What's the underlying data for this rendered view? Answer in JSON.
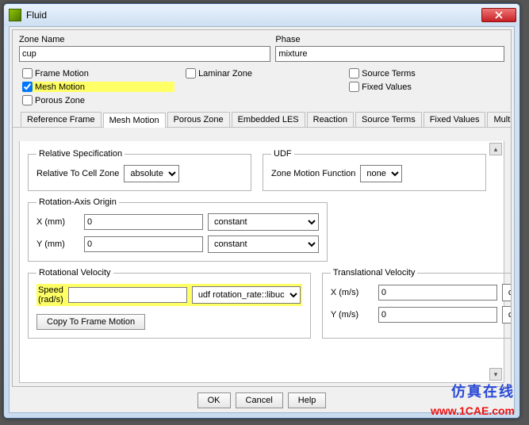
{
  "window": {
    "title": "Fluid"
  },
  "zone": {
    "name_label": "Zone Name",
    "name_value": "cup",
    "phase_label": "Phase",
    "phase_value": "mixture"
  },
  "options": {
    "frame_motion": {
      "label": "Frame Motion",
      "checked": false
    },
    "laminar_zone": {
      "label": "Laminar Zone",
      "checked": false
    },
    "source_terms": {
      "label": "Source Terms",
      "checked": false
    },
    "mesh_motion": {
      "label": "Mesh Motion",
      "checked": true
    },
    "fixed_values": {
      "label": "Fixed Values",
      "checked": false
    },
    "porous_zone": {
      "label": "Porous Zone",
      "checked": false
    }
  },
  "tabs": {
    "reference_frame": "Reference Frame",
    "mesh_motion": "Mesh Motion",
    "porous_zone": "Porous Zone",
    "embedded_les": "Embedded LES",
    "reaction": "Reaction",
    "source_terms": "Source Terms",
    "fixed_values": "Fixed Values",
    "multiphase": "Multiphase"
  },
  "panel": {
    "rel_spec_legend": "Relative Specification",
    "rel_spec_label": "Relative To Cell Zone",
    "rel_spec_value": "absolute",
    "udf_legend": "UDF",
    "udf_label": "Zone Motion Function",
    "udf_value": "none",
    "axis_legend": "Rotation-Axis Origin",
    "x_label": "X (mm)",
    "x_value": "0",
    "x_mode": "constant",
    "y_label": "Y (mm)",
    "y_value": "0",
    "y_mode": "constant",
    "rotvel_legend": "Rotational Velocity",
    "speed_label": "Speed (rad/s)",
    "speed_value": "",
    "speed_mode": "udf rotation_rate::libuc",
    "copy_btn": "Copy To Frame Motion",
    "transvel_legend": "Translational Velocity",
    "tx_label": "X (m/s)",
    "tx_value": "0",
    "tx_mode": "constant",
    "ty_label": "Y (m/s)",
    "ty_value": "0",
    "ty_mode": "constant"
  },
  "buttons": {
    "ok": "OK",
    "cancel": "Cancel",
    "help": "Help"
  },
  "watermark": {
    "cn": "仿真在线",
    "url": "www.1CAE.com"
  }
}
